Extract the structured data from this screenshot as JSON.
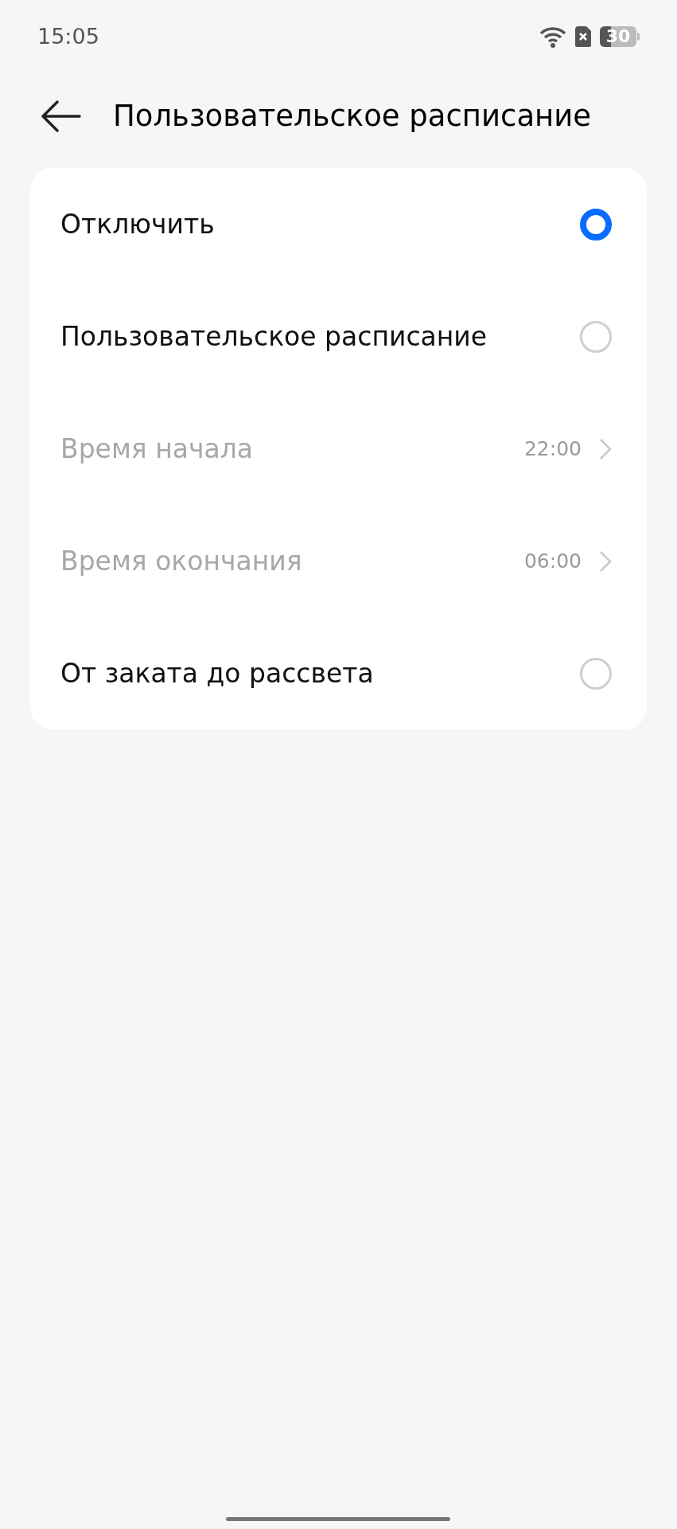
{
  "status_bar": {
    "time": "15:05",
    "battery": "30"
  },
  "header": {
    "title": "Пользовательское расписание"
  },
  "options": [
    {
      "kind": "radio",
      "label": "Отключить",
      "selected": true
    },
    {
      "kind": "radio",
      "label": "Пользовательское расписание",
      "selected": false
    },
    {
      "kind": "time",
      "label": "Время начала",
      "value": "22:00",
      "disabled": true
    },
    {
      "kind": "time",
      "label": "Время окончания",
      "value": "06:00",
      "disabled": true
    },
    {
      "kind": "radio",
      "label": "От заката до рассвета",
      "selected": false
    }
  ]
}
